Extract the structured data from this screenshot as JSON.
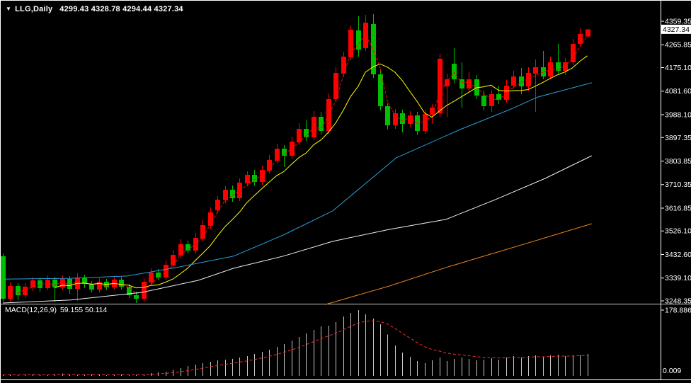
{
  "header": {
    "dropdown_icon": "▼",
    "symbol": "LLG,Daily",
    "ohlc": "4299.43 4328.78 4294.44 4327.34"
  },
  "macd": {
    "name": "MACD(12,26,9)",
    "values": "59.155 50.114"
  },
  "price_axis": {
    "ticks": [
      "4359.35",
      "4265.85",
      "4175.10",
      "4081.60",
      "3988.10",
      "3897.35",
      "3803.85",
      "3710.35",
      "3616.85",
      "3526.10",
      "3432.60",
      "3339.10",
      "3248.35"
    ],
    "current": "4327.34"
  },
  "macd_axis": {
    "max": "178.886",
    "min": "0.009"
  },
  "colors": {
    "background": "#000000",
    "border": "#ffffff",
    "bull_candle": "#ff0000",
    "bear_candle": "#00bf00",
    "ma_fast": "#ff0000",
    "ma_slow": "#ffff00",
    "ma_medium": "#2a9fd8",
    "ma_long": "#f0f0f0",
    "ma_longest": "#e8821e",
    "macd_bars": "#c8c8c8",
    "macd_signal": "#ff2a2a",
    "axis_text": "#ffffff",
    "current_tag_bg": "#ffffff",
    "current_tag_text": "#000000"
  },
  "chart_data": [
    {
      "type": "candlestick",
      "title": "LLG,Daily",
      "last_ohlc": {
        "open": 4299.43,
        "high": 4328.78,
        "low": 4294.44,
        "close": 4327.34
      },
      "ylim": [
        3248.35,
        4359.35
      ],
      "candles": [
        [
          3425.5,
          3436.8,
          3245.5,
          3256.8
        ],
        [
          3256.8,
          3321.5,
          3245.5,
          3307.4
        ],
        [
          3307.4,
          3318.7,
          3251.2,
          3270.8
        ],
        [
          3270.8,
          3318.7,
          3259.6,
          3304.6
        ],
        [
          3301.8,
          3344.0,
          3287.7,
          3329.9
        ],
        [
          3329.9,
          3341.2,
          3284.9,
          3299.0
        ],
        [
          3299.0,
          3349.6,
          3290.5,
          3332.7
        ],
        [
          3332.7,
          3344.0,
          3242.7,
          3301.8
        ],
        [
          3301.8,
          3349.6,
          3290.5,
          3335.5
        ],
        [
          3335.5,
          3346.8,
          3276.5,
          3296.2
        ],
        [
          3296.2,
          3358.0,
          3248.3,
          3341.2
        ],
        [
          3341.2,
          3352.4,
          3299.0,
          3315.9
        ],
        [
          3315.9,
          3327.1,
          3282.1,
          3293.4
        ],
        [
          3293.4,
          3338.4,
          3282.1,
          3324.3
        ],
        [
          3324.3,
          3335.5,
          3290.5,
          3301.8
        ],
        [
          3301.8,
          3346.8,
          3293.4,
          3332.7
        ],
        [
          3332.7,
          3344.0,
          3293.4,
          3304.6
        ],
        [
          3304.6,
          3315.9,
          3259.6,
          3270.8
        ],
        [
          3270.8,
          3284.9,
          3239.9,
          3256.8
        ],
        [
          3256.8,
          3338.4,
          3245.5,
          3324.3
        ],
        [
          3321.5,
          3377.7,
          3310.2,
          3360.8
        ],
        [
          3360.8,
          3374.9,
          3329.9,
          3341.2
        ],
        [
          3341.2,
          3408.7,
          3329.9,
          3391.8
        ],
        [
          3389.0,
          3450.9,
          3377.7,
          3431.2
        ],
        [
          3428.4,
          3493.1,
          3417.1,
          3473.4
        ],
        [
          3473.4,
          3487.4,
          3436.8,
          3448.1
        ],
        [
          3448.1,
          3518.4,
          3436.8,
          3498.7
        ],
        [
          3495.9,
          3569.0,
          3484.6,
          3549.3
        ],
        [
          3546.5,
          3619.6,
          3535.2,
          3599.9
        ],
        [
          3608.4,
          3664.6,
          3597.1,
          3650.6
        ],
        [
          3647.8,
          3704.0,
          3636.5,
          3690.0
        ],
        [
          3690.0,
          3706.8,
          3642.1,
          3656.2
        ],
        [
          3656.2,
          3735.0,
          3644.9,
          3718.1
        ],
        [
          3715.3,
          3763.1,
          3704.0,
          3749.0
        ],
        [
          3749.0,
          3768.7,
          3706.8,
          3720.9
        ],
        [
          3720.9,
          3785.6,
          3709.6,
          3768.7
        ],
        [
          3765.9,
          3827.8,
          3754.6,
          3808.1
        ],
        [
          3805.3,
          3872.8,
          3794.0,
          3853.1
        ],
        [
          3853.1,
          3867.1,
          3780.0,
          3825.0
        ],
        [
          3825.0,
          3900.9,
          3813.7,
          3881.2
        ],
        [
          3878.4,
          3954.3,
          3867.1,
          3931.8
        ],
        [
          3931.8,
          3965.6,
          3884.0,
          3898.1
        ],
        [
          3898.1,
          4002.1,
          3886.8,
          3979.6
        ],
        [
          3979.6,
          3999.3,
          3909.3,
          3923.4
        ],
        [
          3923.4,
          4072.4,
          3912.1,
          4049.9
        ],
        [
          4049.9,
          4176.5,
          4038.7,
          4154.0
        ],
        [
          4151.2,
          4238.4,
          4139.9,
          4218.7
        ],
        [
          4215.9,
          4342.5,
          4204.7,
          4325.6
        ],
        [
          4322.8,
          4379.0,
          4218.7,
          4246.8
        ],
        [
          4252.5,
          4384.7,
          4241.2,
          4353.7
        ],
        [
          4348.1,
          4387.5,
          4134.3,
          4148.4
        ],
        [
          4148.4,
          4168.1,
          4004.9,
          4021.8
        ],
        [
          4021.8,
          4033.1,
          3929.0,
          3945.9
        ],
        [
          3945.9,
          4010.6,
          3931.8,
          3993.7
        ],
        [
          3993.7,
          4007.8,
          3917.8,
          3951.5
        ],
        [
          3951.5,
          4002.1,
          3937.4,
          3985.3
        ],
        [
          3985.3,
          3999.3,
          3906.5,
          3923.4
        ],
        [
          3923.4,
          4007.8,
          3912.1,
          3990.9
        ],
        [
          3988.1,
          4030.3,
          3951.5,
          4016.2
        ],
        [
          3993.7,
          4230.0,
          3979.6,
          4210.3
        ],
        [
          4100.6,
          4151.2,
          3979.6,
          4128.7
        ],
        [
          4190.6,
          4252.5,
          4111.8,
          4128.7
        ],
        [
          4128.7,
          4196.2,
          4016.2,
          4092.1
        ],
        [
          4092.1,
          4156.8,
          4078.1,
          4128.7
        ],
        [
          4128.7,
          4145.6,
          4050.0,
          4064.0
        ],
        [
          4064.0,
          4083.7,
          4004.9,
          4021.8
        ],
        [
          4021.8,
          4086.5,
          3999.3,
          4069.6
        ],
        [
          4069.6,
          4103.4,
          4030.3,
          4047.1
        ],
        [
          4047.1,
          4125.9,
          4035.9,
          4103.4
        ],
        [
          4103.4,
          4162.5,
          4092.1,
          4140.0
        ],
        [
          4140.0,
          4173.7,
          4069.6,
          4100.6
        ],
        [
          4100.6,
          4176.5,
          4083.7,
          4154.0
        ],
        [
          4151.2,
          4207.5,
          3999.3,
          4176.5
        ],
        [
          4176.5,
          4241.2,
          4128.7,
          4140.0
        ],
        [
          4140.0,
          4218.7,
          4128.7,
          4196.2
        ],
        [
          4196.2,
          4269.3,
          4151.2,
          4162.5
        ],
        [
          4162.5,
          4213.1,
          4145.6,
          4196.2
        ],
        [
          4196.2,
          4289.0,
          4185.0,
          4269.3
        ],
        [
          4269.3,
          4331.2,
          4258.1,
          4308.7
        ],
        [
          4299.43,
          4328.78,
          4294.44,
          4327.34
        ]
      ],
      "overlays": [
        {
          "name": "ma-fast",
          "color": "#ff0000",
          "dash": "4 2",
          "computed": "sma",
          "period": 3
        },
        {
          "name": "ma-slow",
          "color": "#ffff00",
          "dash": "",
          "computed": "sma",
          "period": 8
        },
        {
          "name": "ma-medium",
          "color": "#2a9fd8",
          "dash": "",
          "points": [
            [
              0,
              3335
            ],
            [
              9.2,
              3338
            ],
            [
              16.8,
              3347
            ],
            [
              23.5,
              3381
            ],
            [
              31.2,
              3426
            ],
            [
              37.9,
              3510
            ],
            [
              44.6,
              3606
            ],
            [
              53.2,
              3817
            ],
            [
              61.8,
              3929
            ],
            [
              68.5,
              4008
            ],
            [
              72.3,
              4058
            ],
            [
              79.6,
              4115
            ]
          ]
        },
        {
          "name": "ma-long",
          "color": "#f0f0f0",
          "dash": "",
          "points": [
            [
              0,
              3240
            ],
            [
              9.2,
              3252
            ],
            [
              18.8,
              3282
            ],
            [
              26.4,
              3330
            ],
            [
              31.2,
              3378
            ],
            [
              37.9,
              3426
            ],
            [
              44.6,
              3485
            ],
            [
              52.2,
              3532
            ],
            [
              59.9,
              3572
            ],
            [
              66.6,
              3651
            ],
            [
              73.3,
              3735
            ],
            [
              79.6,
              3825
            ]
          ]
        },
        {
          "name": "ma-longest",
          "color": "#e8821e",
          "dash": "",
          "points": [
            [
              43.6,
              3234
            ],
            [
              52.2,
              3307
            ],
            [
              59.9,
              3381
            ],
            [
              66.6,
              3440
            ],
            [
              73.3,
              3499
            ],
            [
              79.6,
              3555
            ]
          ]
        }
      ]
    },
    {
      "type": "bar",
      "name": "MACD(12,26,9)",
      "macd_value": 59.155,
      "signal_value": 50.114,
      "ylim": [
        0,
        178.886
      ],
      "values": [
        3,
        5,
        2,
        4,
        6,
        3,
        2,
        5,
        7,
        4,
        2,
        3,
        5,
        4,
        2,
        3,
        4,
        2,
        3,
        5,
        8,
        10,
        12,
        17,
        21,
        27,
        31,
        35,
        38,
        42,
        44,
        46,
        50,
        54,
        60,
        65,
        71,
        79,
        87,
        96,
        106,
        115,
        125,
        135,
        137,
        146,
        162,
        171,
        179,
        167,
        156,
        140,
        113,
        83,
        63,
        52,
        40,
        35,
        42,
        50,
        40,
        46,
        50,
        46,
        42,
        44,
        48,
        44,
        50,
        54,
        50,
        54,
        56,
        52,
        56,
        58,
        54,
        56,
        57,
        59.155
      ],
      "signal": "ema9"
    }
  ]
}
